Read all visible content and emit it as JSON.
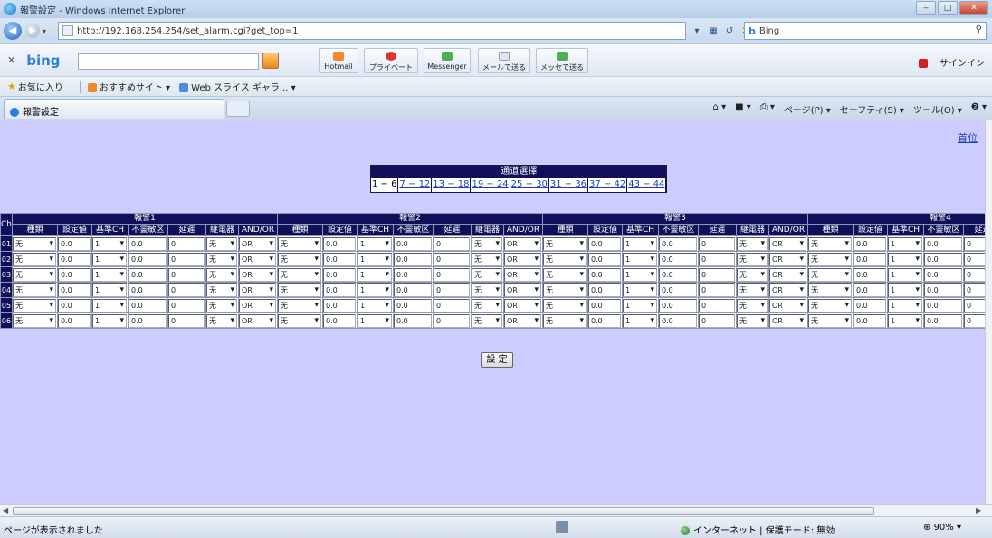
{
  "window": {
    "title": "報警設定 - Windows Internet Explorer",
    "buttons": [
      "‒",
      "□",
      "✕"
    ]
  },
  "address": {
    "url": "http://192.168.254.254/set_alarm.cgi?get_top=1",
    "search_label": "Bing"
  },
  "bing_toolbar": {
    "buttons": [
      "Hotmail",
      "プライベート",
      "Messenger",
      "メールで送る",
      "メッセで送る"
    ],
    "sign_in": "サインイン"
  },
  "favorites": {
    "label": "お気に入り",
    "items": [
      "おすすめサイト ▾",
      "Web スライス ギャラ... ▾"
    ]
  },
  "tab": {
    "title": "報警設定"
  },
  "command_bar": [
    "ページ(P) ▾",
    "セーフティ(S) ▾",
    "ツール(O) ▾",
    "❷ ▾"
  ],
  "page": {
    "top_link": "首位",
    "channel_select": {
      "caption": "通道選擇",
      "ranges": [
        "1 − 6",
        "7 − 12",
        "13 − 18",
        "19 − 24",
        "25 − 30",
        "31 − 36",
        "37 − 42",
        "43 − 44"
      ],
      "current": 0
    },
    "table": {
      "ch_header": "Ch",
      "groups": [
        "報警1",
        "報警2",
        "報警3",
        "報警4"
      ],
      "columns": [
        "種類",
        "設定値",
        "基準CH",
        "不靈敏区",
        "延遲",
        "継電器",
        "AND/OR"
      ],
      "rows": [
        {
          "ch": "01",
          "type": "无",
          "setting": "0.0",
          "base_ch": "1",
          "deadband": "0.0",
          "delay": "0",
          "relay": "无",
          "logic": "OR"
        },
        {
          "ch": "02",
          "type": "无",
          "setting": "0.0",
          "base_ch": "1",
          "deadband": "0.0",
          "delay": "0",
          "relay": "无",
          "logic": "OR"
        },
        {
          "ch": "03",
          "type": "无",
          "setting": "0.0",
          "base_ch": "1",
          "deadband": "0.0",
          "delay": "0",
          "relay": "无",
          "logic": "OR"
        },
        {
          "ch": "04",
          "type": "无",
          "setting": "0.0",
          "base_ch": "1",
          "deadband": "0.0",
          "delay": "0",
          "relay": "无",
          "logic": "OR"
        },
        {
          "ch": "05",
          "type": "无",
          "setting": "0.0",
          "base_ch": "1",
          "deadband": "0.0",
          "delay": "0",
          "relay": "无",
          "logic": "OR"
        },
        {
          "ch": "06",
          "type": "无",
          "setting": "0.0",
          "base_ch": "1",
          "deadband": "0.0",
          "delay": "0",
          "relay": "无",
          "logic": "OR"
        }
      ]
    },
    "submit_label": "設 定"
  },
  "status": {
    "message": "ページが表示されました",
    "zone": "インターネット | 保護モード: 無効",
    "zoom": "90%"
  }
}
